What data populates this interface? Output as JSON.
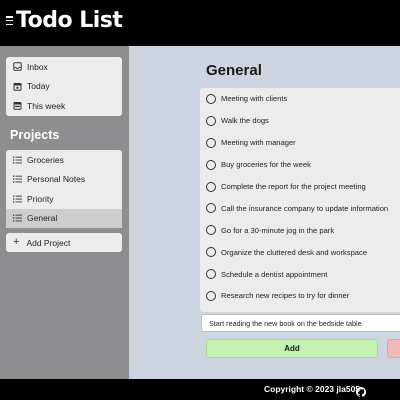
{
  "app": {
    "title": "Todo List"
  },
  "sidebar": {
    "views": [
      {
        "label": "Inbox",
        "icon": "inbox-icon"
      },
      {
        "label": "Today",
        "icon": "calendar-day-icon"
      },
      {
        "label": "This week",
        "icon": "calendar-week-icon"
      }
    ],
    "projects_heading": "Projects",
    "projects": [
      {
        "label": "Groceries",
        "icon": "list-icon"
      },
      {
        "label": "Personal Notes",
        "icon": "list-icon"
      },
      {
        "label": "Priority",
        "icon": "list-icon"
      },
      {
        "label": "General",
        "icon": "list-icon",
        "active": true
      }
    ],
    "add_project_label": "Add Project"
  },
  "main": {
    "title": "General",
    "tasks": [
      "Meeting with clients",
      "Walk the dogs",
      "Meeting with manager",
      "Buy groceries for the week",
      "Complete the report for the project meeting",
      "Call the insurance company to update information",
      "Go for a 30-minute jog in the park",
      "Organize the cluttered desk and workspace",
      "Schedule a dentist appointment",
      "Research new recipes to try for dinner"
    ],
    "new_task_value": "Start reading the new book on the bedside table",
    "add_label": "Add"
  },
  "footer": {
    "copyright": "Copyright © 2023 jla505",
    "icon": "github-icon"
  },
  "colors": {
    "header_bg": "#000000",
    "sidebar_bg": "#8e8e90",
    "main_bg": "#ccd5e0",
    "add_button": "#c2f2b2",
    "cancel_button": "#f2b9b9"
  }
}
